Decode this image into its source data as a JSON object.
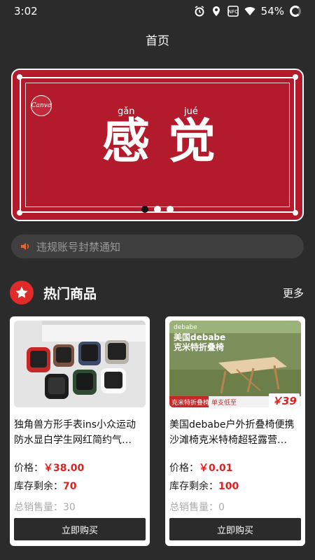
{
  "status_bar": {
    "time": "3:02",
    "battery": "54%",
    "icons": [
      "alarm-icon",
      "location-icon",
      "nfc-icon",
      "wifi-icon"
    ]
  },
  "header": {
    "title": "首页"
  },
  "banner": {
    "pinyin_1": "gǎn",
    "pinyin_2": "jué",
    "char_1": "感",
    "char_2": "觉",
    "logo": "Canva",
    "page_count": 3,
    "active_page": 1,
    "color": "#b31b2d"
  },
  "notice": {
    "text": "违规账号封禁通知",
    "icon": "speaker-icon"
  },
  "hot_section": {
    "title": "热门商品",
    "more": "更多",
    "icon": "star-icon"
  },
  "products": [
    {
      "name": "独角兽方形手表ins小众运动防水显白学生网红简约气质手表",
      "name_display": "独角兽方形手表ins小众运动防水显白学生网红简约气…",
      "price_label": "价格：",
      "price": "￥38.00",
      "stock_label": "库存剩余：",
      "stock": "70",
      "sales_label": "总销售量：",
      "sales": "30",
      "button": "立即购买"
    },
    {
      "name": "美国debabe户外折叠椅便携沙滩椅克米特椅超轻露营椅",
      "name_display": "美国debabe户外折叠椅便携沙滩椅克米特椅超轻露营…",
      "price_label": "价格：",
      "price": "￥0.01",
      "stock_label": "库存剩余：",
      "stock": "100",
      "sales_label": "总销售量：",
      "sales": "0",
      "button": "立即购买",
      "thumb": {
        "brand": "debabe",
        "headline_1": "美国debabe",
        "headline_2": "克米特折叠椅",
        "tagline": "克米特折叠椅",
        "tagline_2": "单支低至",
        "price_tag": "￥39",
        "price_tag_suffix": "¥"
      }
    }
  ]
}
